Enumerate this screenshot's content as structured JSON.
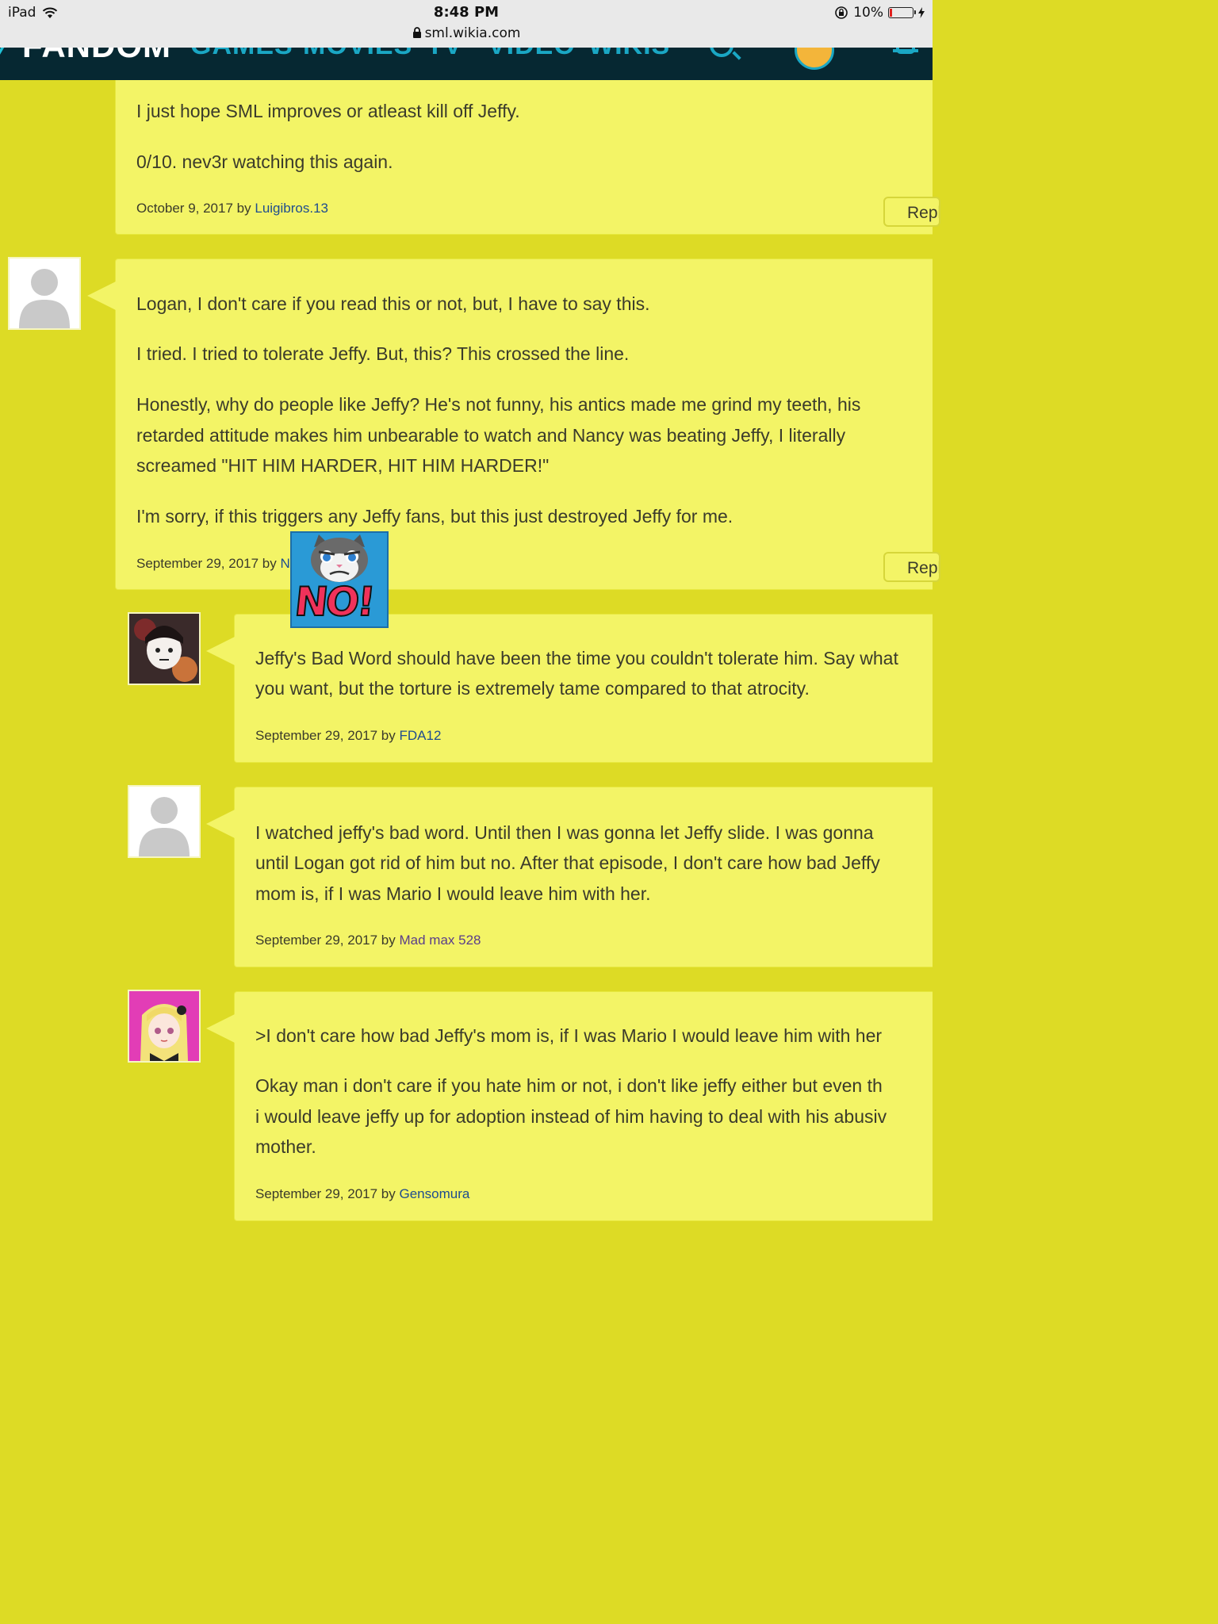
{
  "status_bar": {
    "device": "iPad",
    "time": "8:48 PM",
    "url": "sml.wikia.com",
    "battery": "10%",
    "battery_level": 0.1
  },
  "header": {
    "logo": "FANDOM",
    "nav": [
      "GAMES",
      "MOVIES",
      "TV",
      "VIDEO",
      "WIKIS"
    ]
  },
  "comments": [
    {
      "paragraphs": [
        "I just hope SML improves or atleast kill off Jeffy.",
        "0/10. nev3r watching this again."
      ],
      "date": "October 9, 2017",
      "by": "by",
      "author": "Luigibros.13",
      "reply": "Reply"
    },
    {
      "paragraphs": [
        "Logan, I don't care if you read this or not, but, I have to say this.",
        "I tried. I tried to tolerate Jeffy. But, this? This crossed the line.",
        "Honestly, why do people like Jeffy? He's not funny, his antics made me grind my teeth, his",
        "retarded attitude makes him unbearable to watch and Nancy was beating Jeffy, I literally",
        "screamed \"HIT HIM HARDER, HIT HIM HARDER!\"",
        "I'm sorry, if this triggers any Jeffy fans, but this just destroyed Jeffy for me."
      ],
      "date": "September 29, 2017",
      "by": "by",
      "author": "N",
      "reply": "Reply"
    },
    {
      "paragraphs": [
        "Jeffy's Bad Word should have been the time you couldn't tolerate him. Say what",
        "you want, but the torture is extremely tame compared to that atrocity."
      ],
      "date": "September 29, 2017",
      "by": "by",
      "author": "FDA12"
    },
    {
      "paragraphs": [
        "I watched jeffy's bad word. Until then I was gonna let Jeffy slide. I was gonna",
        "until Logan got rid of him but no. After that episode, I don't care how bad Jeffy",
        "mom is, if I was Mario I would leave him with her."
      ],
      "date": "September 29, 2017",
      "by": "by",
      "author": "Mad max 528"
    },
    {
      "paragraphs": [
        ">I don't care how bad Jeffy's mom is, if I was Mario I would leave him with her",
        "Okay man i don't care if you hate him or not, i don't like jeffy either but even th",
        "i would leave jeffy up for adoption instead of him having to deal with his abusiv",
        "mother."
      ],
      "date": "September 29, 2017",
      "by": "by",
      "author": "Gensomura"
    }
  ],
  "sticker": {
    "text": "NO!"
  },
  "colors": {
    "page_bg": "#dddb25",
    "card_bg": "#f3f466",
    "header_bg": "#062832",
    "link": "#1f4d8e",
    "author_purple": "#5a3d8a"
  }
}
